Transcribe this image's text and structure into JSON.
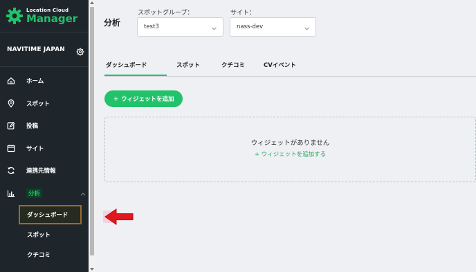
{
  "brand": {
    "small": "Location Cloud",
    "big": "Manager"
  },
  "org": {
    "name": "NAVITIME JAPAN"
  },
  "nav": {
    "items": [
      {
        "label": "ホーム",
        "icon": "home-icon"
      },
      {
        "label": "スポット",
        "icon": "location-pin-icon"
      },
      {
        "label": "投稿",
        "icon": "edit-icon"
      },
      {
        "label": "サイト",
        "icon": "window-icon"
      },
      {
        "label": "連携先情報",
        "icon": "sync-icon"
      },
      {
        "label": "分析",
        "icon": "bar-chart-icon"
      }
    ],
    "sub_items": [
      {
        "label": "ダッシュボード"
      },
      {
        "label": "スポット"
      },
      {
        "label": "クチコミ"
      }
    ]
  },
  "main": {
    "title": "分析",
    "spot_group_label": "スポットグループ：",
    "spot_group_value": "test3",
    "site_label": "サイト：",
    "site_value": "nass-dev",
    "tabs": [
      {
        "label": "ダッシュボード"
      },
      {
        "label": "スポット"
      },
      {
        "label": "クチコミ"
      },
      {
        "label": "CVイベント"
      }
    ],
    "add_widget_button": "ウィジェットを追加",
    "add_widget_plus": "+",
    "empty_message": "ウィジェットがありません",
    "empty_link": "+ ウィジェットを追加する"
  },
  "colors": {
    "accent": "#22c26a",
    "sidebar_bg": "#1e262c",
    "highlight_border": "#9b6b2a",
    "arrow": "#e0191c"
  }
}
